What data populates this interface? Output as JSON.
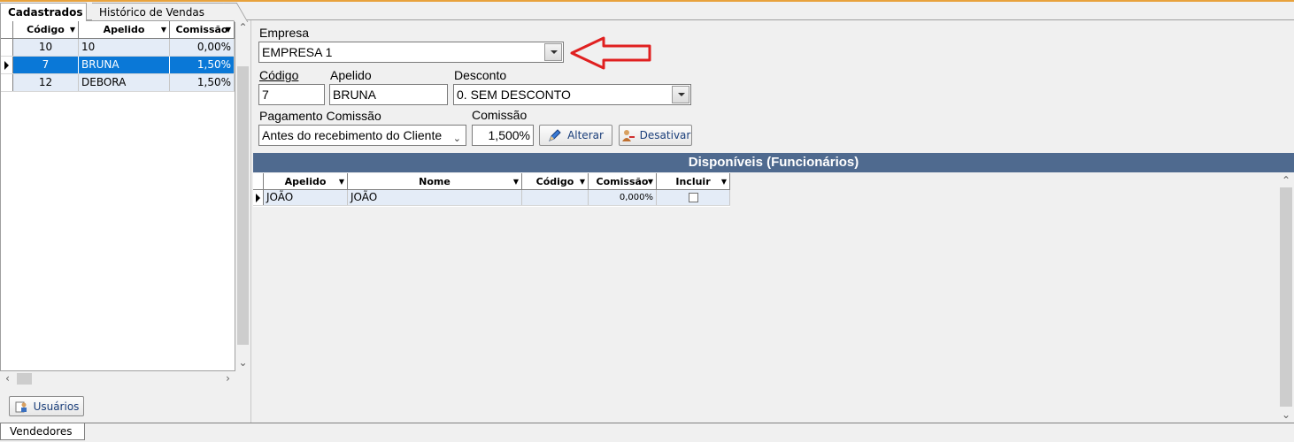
{
  "tabs": [
    {
      "label": "Cadastrados",
      "active": true
    },
    {
      "label": "Histórico de Vendas",
      "active": false
    }
  ],
  "left_grid": {
    "columns": [
      "Código",
      "Apelido",
      "Comissão"
    ],
    "rows": [
      {
        "codigo": "10",
        "apelido": "10",
        "comissao": "0,00%"
      },
      {
        "codigo": "7",
        "apelido": "BRUNA",
        "comissao": "1,50%"
      },
      {
        "codigo": "12",
        "apelido": "DEBORA",
        "comissao": "1,50%"
      }
    ],
    "selected_index": 1
  },
  "usuarios_button": "Usuários",
  "form": {
    "empresa_label": "Empresa",
    "empresa_value": "EMPRESA 1",
    "codigo_label": "Código",
    "codigo_value": "7",
    "apelido_label": "Apelido",
    "apelido_value": "BRUNA",
    "desconto_label": "Desconto",
    "desconto_value": "0. SEM DESCONTO",
    "pagamento_label": "Pagamento Comissão",
    "pagamento_value": "Antes do recebimento do Cliente",
    "comissao_label": "Comissão",
    "comissao_value": "1,500%",
    "alterar_button": "Alterar",
    "desativar_button": "Desativar"
  },
  "disponiveis": {
    "title": "Disponíveis (Funcionários)",
    "columns": [
      "Apelido",
      "Nome",
      "Código",
      "Comissão",
      "Incluir"
    ],
    "rows": [
      {
        "apelido": "JOÃO",
        "nome": "JOÃO",
        "codigo": "",
        "comissao": "0,000%",
        "incluir": false
      }
    ]
  },
  "bottom_tab": "Vendedores",
  "colors": {
    "selection": "#0a78d7",
    "section_bar": "#4f6a8f",
    "arrow": "#e02020",
    "accent_line": "#e8a23c"
  }
}
